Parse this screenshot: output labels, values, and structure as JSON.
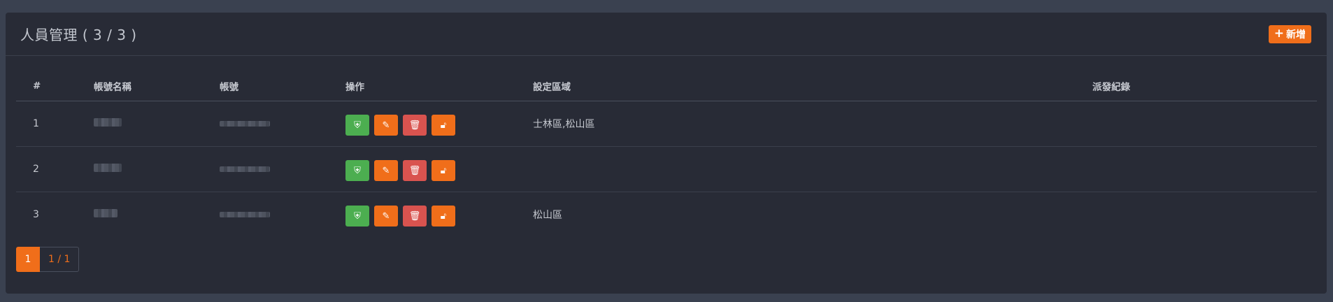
{
  "header": {
    "title": "人員管理 ( 3 / 3 )",
    "add_label": "新增"
  },
  "table": {
    "columns": [
      "#",
      "帳號名稱",
      "帳號",
      "操作",
      "設定區域",
      "派發紀錄"
    ],
    "rows": [
      {
        "index": "1",
        "area": "士林區,松山區",
        "record": ""
      },
      {
        "index": "2",
        "area": "",
        "record": ""
      },
      {
        "index": "3",
        "area": "松山區",
        "record": ""
      }
    ]
  },
  "pagination": {
    "current": "1",
    "info": "1 / 1"
  },
  "colors": {
    "accent": "#f06e1a",
    "green": "#4cae50",
    "red": "#d9534f",
    "background": "#282b36"
  },
  "icons": {
    "permission": "shield-icon",
    "edit": "pencil-icon",
    "delete": "trash-icon",
    "unlock": "unlock-icon"
  }
}
